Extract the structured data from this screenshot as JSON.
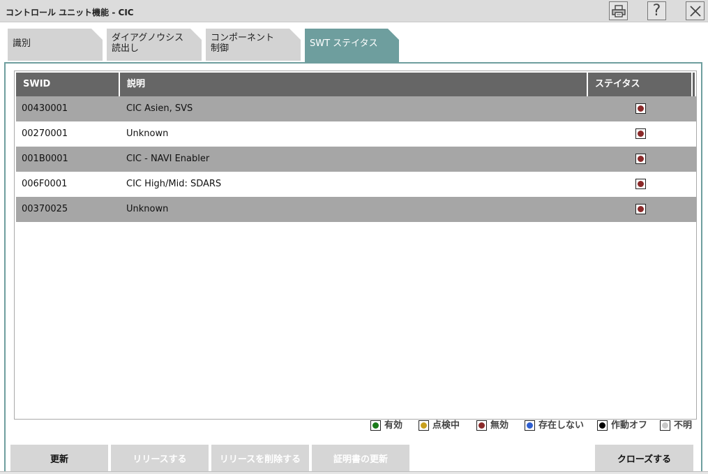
{
  "window": {
    "title": "コントロール ユニット機能 - CIC",
    "print_icon": "printer-icon",
    "help_label": "?",
    "close_icon": "close-icon"
  },
  "tabs": [
    {
      "line1": "識別",
      "line2": "",
      "active": false
    },
    {
      "line1": "ダイアグノウシス",
      "line2": "読出し",
      "active": false
    },
    {
      "line1": "コンポーネント",
      "line2": "制御",
      "active": false
    },
    {
      "line1": "SWT ステイタス",
      "line2": "",
      "active": true
    }
  ],
  "table": {
    "headers": {
      "swid": "SWID",
      "description": "説明",
      "status": "ステイタス"
    },
    "rows": [
      {
        "swid": "00430001",
        "description": "CIC Asien, SVS",
        "status": "無効"
      },
      {
        "swid": "00270001",
        "description": "Unknown",
        "status": "無効"
      },
      {
        "swid": "001B0001",
        "description": "CIC - NAVI Enabler",
        "status": "無効"
      },
      {
        "swid": "006F0001",
        "description": "CIC High/Mid: SDARS",
        "status": "無効"
      },
      {
        "swid": "00370025",
        "description": "Unknown",
        "status": "無効"
      }
    ]
  },
  "legend": [
    {
      "label": "有効",
      "color": "#1a7a1a"
    },
    {
      "label": "点検中",
      "color": "#c8a01e"
    },
    {
      "label": "無効",
      "color": "#8b2a2a"
    },
    {
      "label": "存在しない",
      "color": "#2f5fd0"
    },
    {
      "label": "作動オフ",
      "color": "#000000"
    },
    {
      "label": "不明",
      "color": "#c8c8c8"
    }
  ],
  "buttons": {
    "refresh": "更新",
    "release": "リリースする",
    "delete_release": "リリースを削除する",
    "update_certificate": "証明書の更新",
    "close": "クローズする"
  },
  "colors": {
    "accent": "#6e9e9e",
    "header_bg": "#666666",
    "row_shade": "#a6a6a6",
    "status_invalid": "#8b2a2a"
  }
}
